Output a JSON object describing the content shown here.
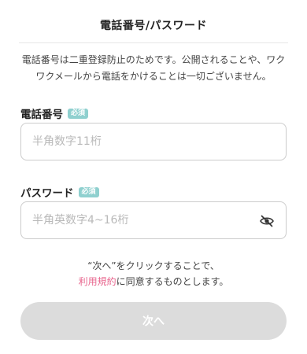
{
  "header": {
    "title": "電話番号/パスワード"
  },
  "notice": {
    "line1": "電話番号は二重登録防止のためです。公開されることや、ワク",
    "line2": "ワクメールから電話をかけることは一切ございません。"
  },
  "phone_field": {
    "label": "電話番号",
    "badge": "必須",
    "placeholder": "半角数字11桁",
    "value": ""
  },
  "password_field": {
    "label": "パスワード",
    "badge": "必須",
    "placeholder": "半角英数字4~16桁",
    "value": "",
    "toggle_icon": "eye-off-icon"
  },
  "agreement": {
    "line1": "“次へ”をクリックすることで、",
    "terms_link": "利用規約",
    "line2_suffix": "に同意するものとします。"
  },
  "next_button": {
    "label": "次へ",
    "state": "disabled"
  },
  "colors": {
    "badge": "#8fd0cf",
    "link": "#e8668e",
    "button_disabled": "#dcdcdc",
    "border": "#cccccc",
    "placeholder": "#b9b9b9"
  }
}
